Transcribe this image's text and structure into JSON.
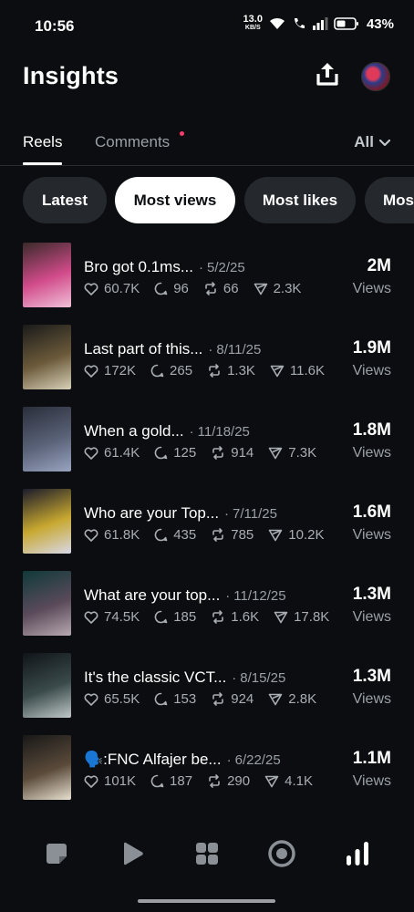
{
  "status_bar": {
    "time": "10:56",
    "net_speed_value": "13.0",
    "net_speed_unit": "KB/S",
    "battery_percent": "43%"
  },
  "header": {
    "title": "Insights",
    "upload_icon": "upload-icon",
    "avatar": "profile-avatar"
  },
  "tabs": {
    "reels": "Reels",
    "comments": "Comments",
    "filter": "All"
  },
  "chips": [
    "Latest",
    "Most views",
    "Most likes",
    "Mos"
  ],
  "active_chip_index": 1,
  "reels": [
    {
      "title": "Bro got 0.1ms...",
      "date": "5/2/25",
      "likes": "60.7K",
      "comments": "96",
      "reposts": "66",
      "shares": "2.3K",
      "views": "2M",
      "views_label": "Views",
      "thumb_colors": [
        "#3a2a2a",
        "#d14b8a",
        "#f0c0d8"
      ]
    },
    {
      "title": "Last part of this...",
      "date": "8/11/25",
      "likes": "172K",
      "comments": "265",
      "reposts": "1.3K",
      "shares": "11.6K",
      "views": "1.9M",
      "views_label": "Views",
      "thumb_colors": [
        "#1a1a1a",
        "#6b5a3a",
        "#d8d0b8"
      ]
    },
    {
      "title": "When a gold...",
      "date": "11/18/25",
      "likes": "61.4K",
      "comments": "125",
      "reposts": "914",
      "shares": "7.3K",
      "views": "1.8M",
      "views_label": "Views",
      "thumb_colors": [
        "#2a2e3a",
        "#5a6278",
        "#9aa4c0"
      ]
    },
    {
      "title": "Who are your Top...",
      "date": "7/11/25",
      "likes": "61.8K",
      "comments": "435",
      "reposts": "785",
      "shares": "10.2K",
      "views": "1.6M",
      "views_label": "Views",
      "thumb_colors": [
        "#1a1a2a",
        "#c8a830",
        "#d8d8e8"
      ]
    },
    {
      "title": "What are your top...",
      "date": "11/12/25",
      "likes": "74.5K",
      "comments": "185",
      "reposts": "1.6K",
      "shares": "17.8K",
      "views": "1.3M",
      "views_label": "Views",
      "thumb_colors": [
        "#0f3a3a",
        "#5a4a5a",
        "#b8a8b0"
      ]
    },
    {
      "title": "It's the classic VCT...",
      "date": "8/15/25",
      "likes": "65.5K",
      "comments": "153",
      "reposts": "924",
      "shares": "2.8K",
      "views": "1.3M",
      "views_label": "Views",
      "thumb_colors": [
        "#101418",
        "#3a4a4a",
        "#c0c8c8"
      ]
    },
    {
      "title": "🗣️:FNC Alfajer be...",
      "date": "6/22/25",
      "likes": "101K",
      "comments": "187",
      "reposts": "290",
      "shares": "4.1K",
      "views": "1.1M",
      "views_label": "Views",
      "thumb_colors": [
        "#181818",
        "#5a4a3a",
        "#e8e0d0"
      ]
    }
  ],
  "bottom_nav": [
    "threads-icon",
    "play-icon",
    "grid-icon",
    "target-icon",
    "insights-bars-icon"
  ]
}
